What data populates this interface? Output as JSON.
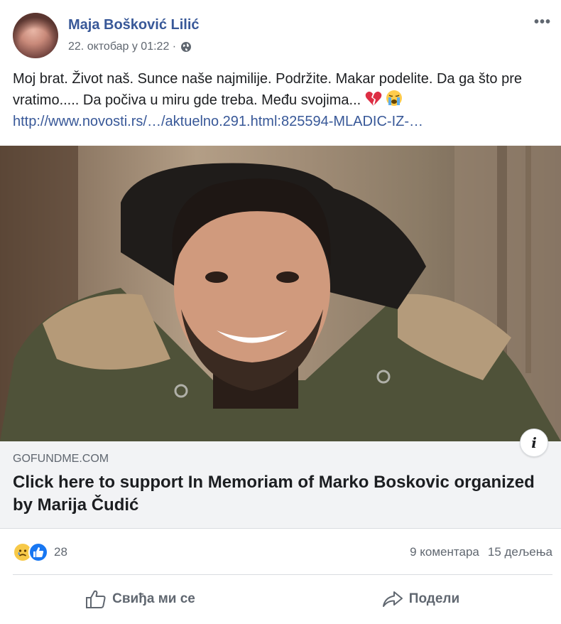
{
  "post": {
    "author": "Maja Bošković Lilić",
    "timestamp": "22. октобар у 01:22 ·",
    "privacy_icon": "globe-icon",
    "text": "Moj brat. Život naš. Sunce naše najmilije. Podržite. Makar podelite. Da ga što pre vratimo..... Da počiva u miru gde treba. Među svojima...",
    "link_text": "http://www.novosti.rs/…/aktuelno.291.html:825594-MLADIC-IZ-…"
  },
  "link_card": {
    "domain": "GOFUNDME.COM",
    "title": "Click here to support In Memoriam of Marko Boskovic organized by Marija Čudić"
  },
  "reactions": {
    "count": "28",
    "comments": "9 коментара",
    "shares": "15 дељења"
  },
  "actions": {
    "like_label": "Свиђа ми се",
    "share_label": "Подели"
  },
  "colors": {
    "author_blue": "#385898",
    "like_blue": "#1877f2",
    "card_bg": "#f2f3f5"
  }
}
